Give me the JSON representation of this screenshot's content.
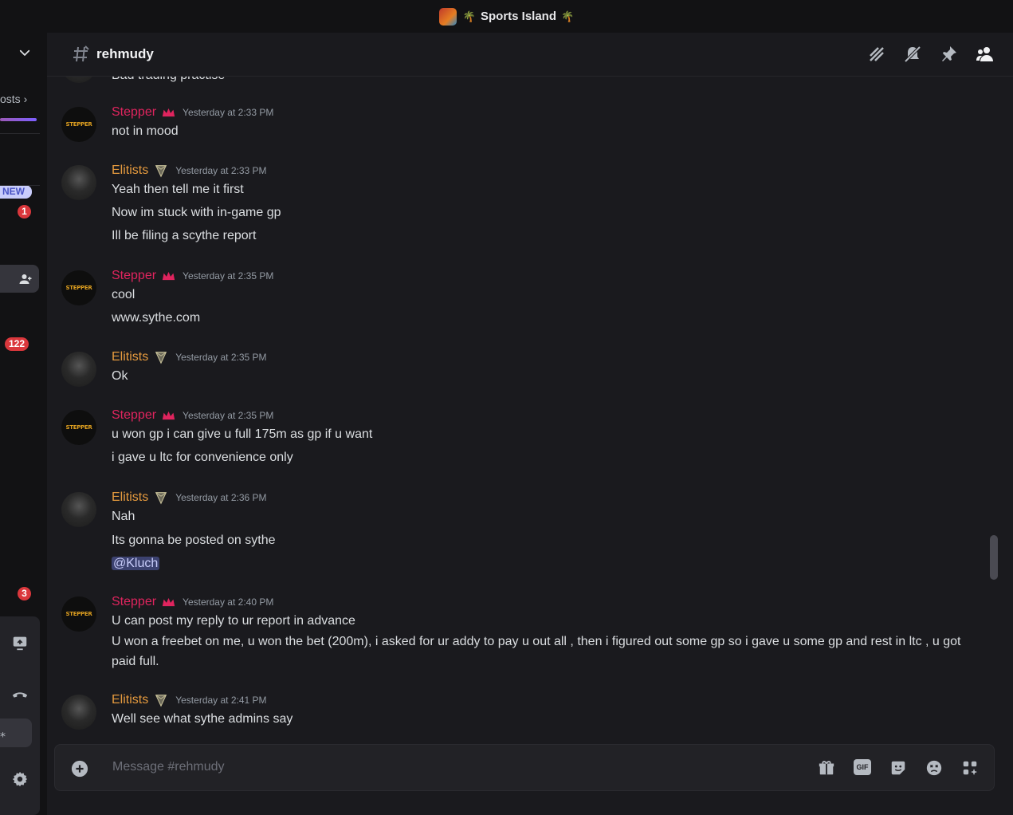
{
  "window": {
    "server_name": "Sports Island",
    "palm_left": "🌴",
    "palm_right": "🌴"
  },
  "sidebar": {
    "posts_label": "osts",
    "new_badge": "NEW",
    "badges": [
      "1",
      "122",
      "3"
    ]
  },
  "header": {
    "channel_name": "rehmudy"
  },
  "messages": [
    {
      "kind": "partial",
      "lines": [
        "Bad trading practise"
      ]
    },
    {
      "author": "Stepper",
      "role": "stepper",
      "time": "Yesterday at 2:33 PM",
      "lines": [
        "not in mood"
      ]
    },
    {
      "author": "Elitists",
      "role": "elitists",
      "time": "Yesterday at 2:33 PM",
      "lines": [
        "Yeah then tell me it first",
        "Now im stuck with in-game gp",
        "Ill be filing a scythe report"
      ]
    },
    {
      "author": "Stepper",
      "role": "stepper",
      "time": "Yesterday at 2:35 PM",
      "lines": [
        "cool",
        "www.sythe.com"
      ]
    },
    {
      "author": "Elitists",
      "role": "elitists",
      "time": "Yesterday at 2:35 PM",
      "lines": [
        "Ok"
      ]
    },
    {
      "author": "Stepper",
      "role": "stepper",
      "time": "Yesterday at 2:35 PM",
      "lines": [
        "u won gp i can give u full 175m as gp if u want",
        "i gave u ltc for convenience only"
      ]
    },
    {
      "author": "Elitists",
      "role": "elitists",
      "time": "Yesterday at 2:36 PM",
      "lines": [
        "Nah",
        "Its gonna be posted on sythe"
      ],
      "mention": "@Kluch"
    },
    {
      "author": "Stepper",
      "role": "stepper",
      "time": "Yesterday at 2:40 PM",
      "lines": [
        "U can post my reply to ur report in advance",
        "U won a freebet on me, u won the bet (200m), i asked for ur addy to pay u out all , then i figured out some gp so i gave u some gp and rest in ltc , u got paid full."
      ]
    },
    {
      "author": "Elitists",
      "role": "elitists",
      "time": "Yesterday at 2:41 PM",
      "lines": [
        "Well see what sythe admins say"
      ]
    }
  ],
  "avatar_text": "STEPPER",
  "composer": {
    "placeholder": "Message #rehmudy",
    "gif_label": "GIF"
  },
  "colors": {
    "stepper": "#e0245e",
    "elitists": "#e59a3e",
    "mention_bg": "#3c4270",
    "badge": "#da373c"
  },
  "icons": [
    "chevron-down-icon",
    "threads-icon",
    "mute-icon",
    "pin-icon",
    "members-icon",
    "gift-icon",
    "gif-icon",
    "sticker-icon",
    "emoji-icon",
    "apps-icon",
    "settings-icon",
    "plus-circle-icon"
  ]
}
